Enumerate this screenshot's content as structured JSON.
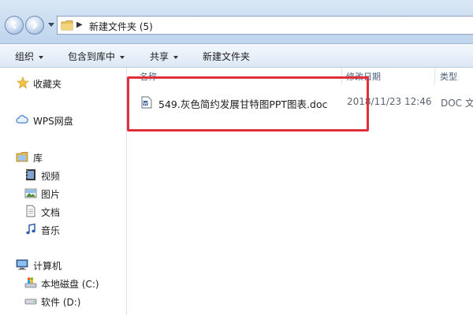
{
  "address": {
    "folder_name": "新建文件夹 (5)"
  },
  "toolbar": {
    "organize": "组织",
    "include_in_library": "包含到库中",
    "share": "共享",
    "new_folder": "新建文件夹"
  },
  "nav": {
    "favorites": "收藏夹",
    "wps_cloud": "WPS网盘",
    "libraries": "库",
    "videos": "视频",
    "pictures": "图片",
    "documents": "文档",
    "music": "音乐",
    "computer": "计算机",
    "local_disk_c": "本地磁盘 (C:)",
    "software_d": "软件 (D:)"
  },
  "columns": {
    "name": "名称",
    "date_modified": "修改日期",
    "type": "类型"
  },
  "files": [
    {
      "name": "549.灰色简约发展甘特图PPT图表.doc",
      "date": "2018/11/23 12:46",
      "type": "DOC 文"
    }
  ],
  "colors": {
    "highlight": "#e0303b",
    "toolbar_bg": "#dde8f5",
    "address_bg": "#c8dbf0"
  }
}
